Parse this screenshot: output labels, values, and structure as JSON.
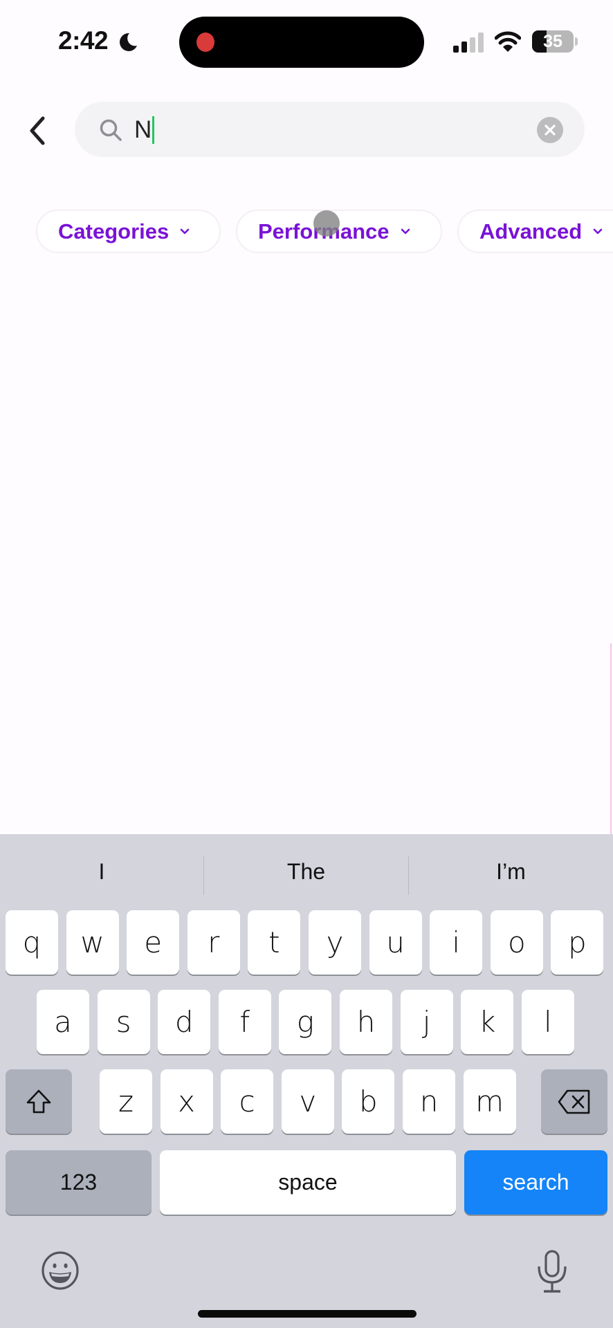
{
  "status_bar": {
    "time": "2:42",
    "focus_icon": "moon-icon",
    "recording_indicator": "red-dot",
    "signal_bars_active": 2,
    "signal_bars_total": 4,
    "battery_percent": "35"
  },
  "header": {
    "back_icon": "chevron-left-icon",
    "search": {
      "value": "N",
      "icon": "search-icon",
      "clear_icon": "clear-circle-icon"
    }
  },
  "filters": [
    {
      "label": "Categories",
      "icon": "chevron-down-icon"
    },
    {
      "label": "Performance",
      "icon": "chevron-down-icon"
    },
    {
      "label": "Advanced",
      "icon": "chevron-down-icon"
    }
  ],
  "colors": {
    "accent": "#7a12d6",
    "search_key": "#1484f8",
    "caret": "#22c55e"
  },
  "keyboard": {
    "suggestions": [
      "I",
      "The",
      "I’m"
    ],
    "row1": [
      "q",
      "w",
      "e",
      "r",
      "t",
      "y",
      "u",
      "i",
      "o",
      "p"
    ],
    "row2": [
      "a",
      "s",
      "d",
      "f",
      "g",
      "h",
      "j",
      "k",
      "l"
    ],
    "row3": [
      "z",
      "x",
      "c",
      "v",
      "b",
      "n",
      "m"
    ],
    "numbers_label": "123",
    "space_label": "space",
    "return_label": "search",
    "shift_icon": "shift-icon",
    "delete_icon": "delete-backspace-icon",
    "emoji_icon": "emoji-icon",
    "mic_icon": "microphone-icon"
  }
}
